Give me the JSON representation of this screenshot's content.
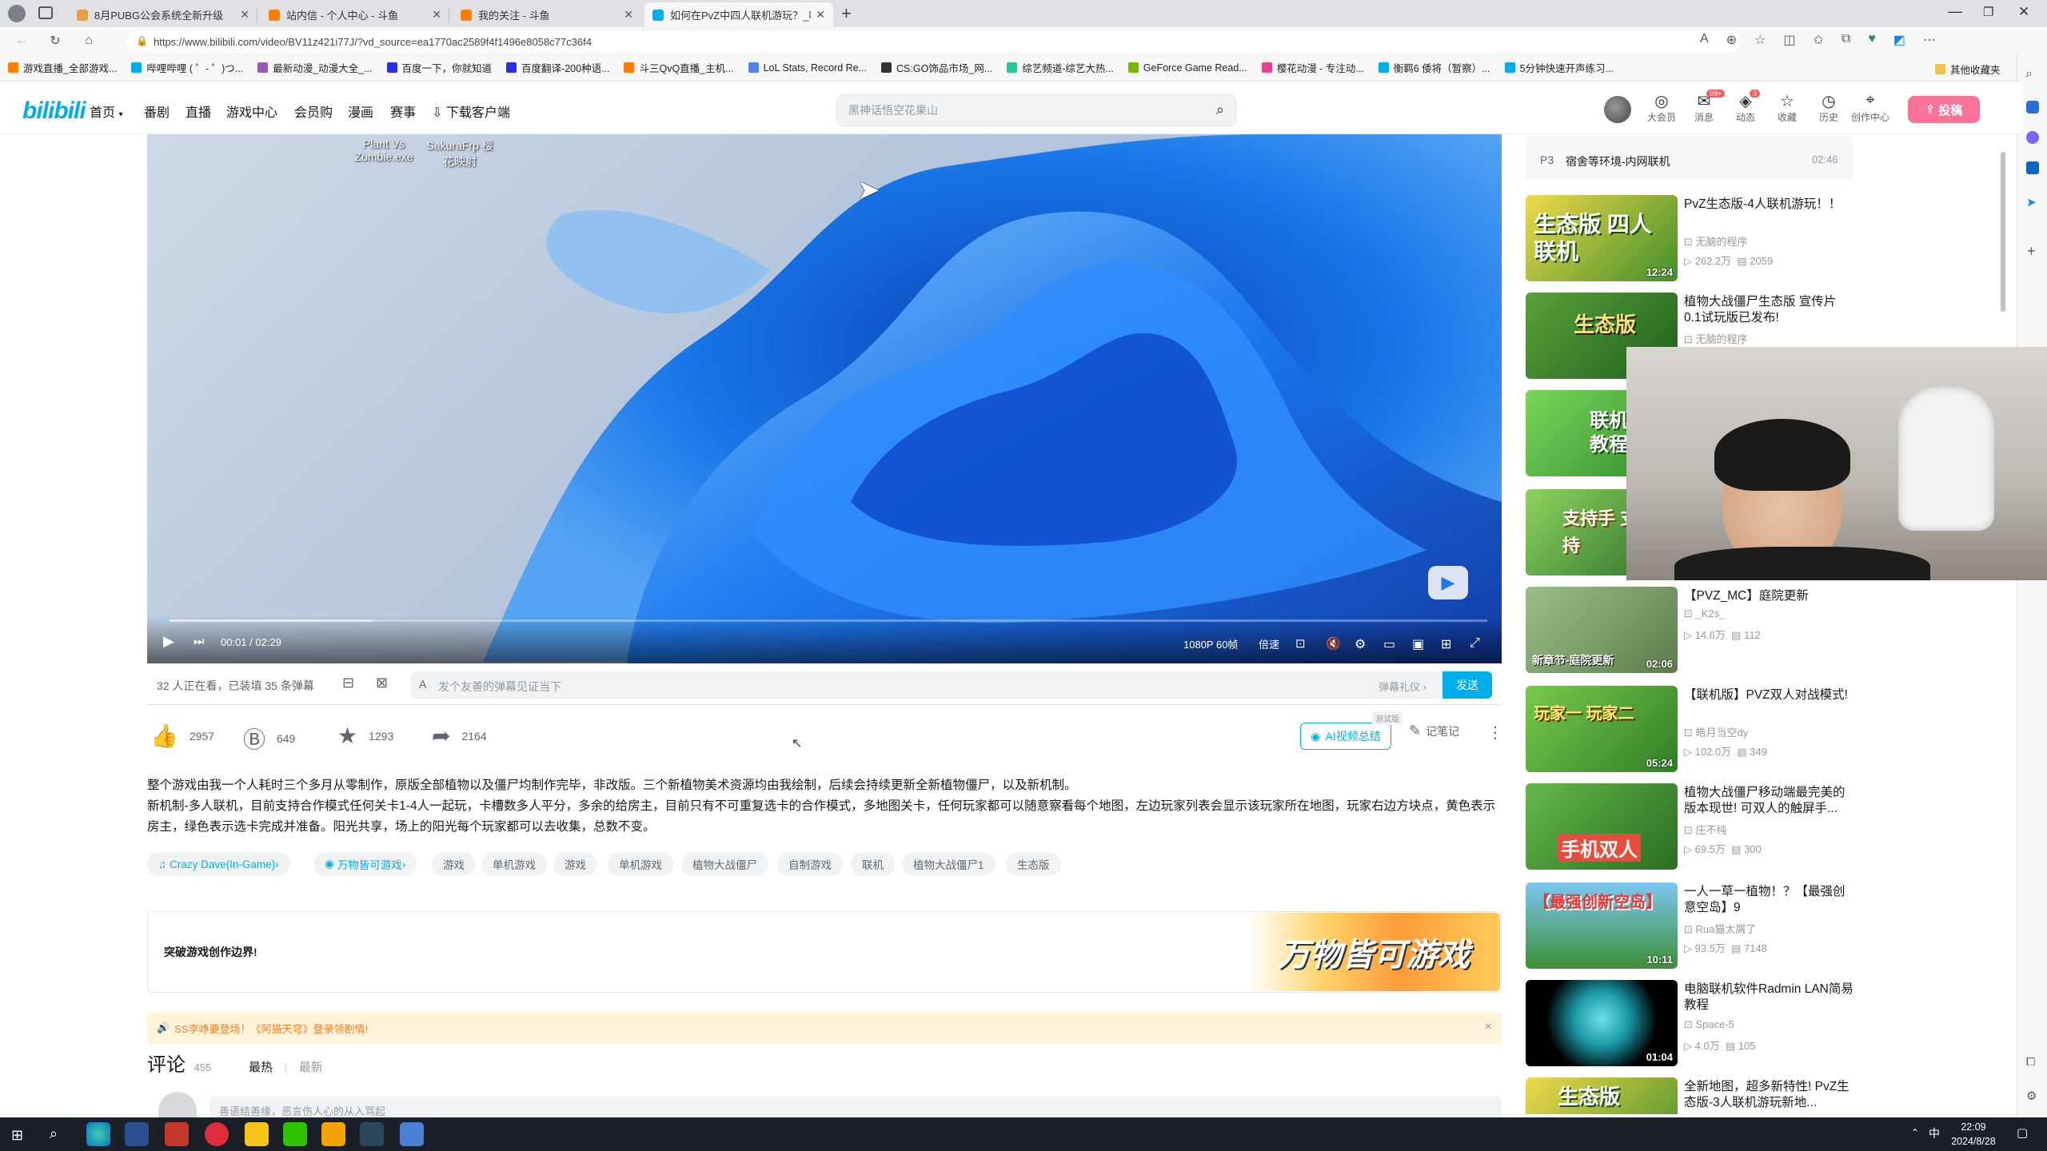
{
  "browser": {
    "tabs": [
      {
        "title": "8月PUBG公会系统全新升级",
        "color": "#e8a040"
      },
      {
        "title": "站内信 - 个人中心 - 斗鱼",
        "color": "#ff7d00"
      },
      {
        "title": "我的关注 - 斗鱼",
        "color": "#ff7d00"
      },
      {
        "title": "如何在PvZ中四人联机游玩？_哔哩",
        "color": "#00aeec"
      }
    ],
    "url": "https://www.bilibili.com/video/BV11z421i77J/?vd_source=ea1770ac2589f4f1496e8058c77c36f4",
    "bookmarks": [
      {
        "label": "游戏直播_全部游戏...",
        "color": "#ff7d00"
      },
      {
        "label": "哔哩哔哩 ( ゜- ゜)つ...",
        "color": "#00aeec"
      },
      {
        "label": "最新动漫_动漫大全_...",
        "color": "#9b59b6"
      },
      {
        "label": "百度一下，你就知道",
        "color": "#2932e1"
      },
      {
        "label": "百度翻译-200种语...",
        "color": "#2932e1"
      },
      {
        "label": "斗三QvQ直播_主机...",
        "color": "#ff7d00"
      },
      {
        "label": "LoL Stats, Record Re...",
        "color": "#5383e8"
      },
      {
        "label": "CS:GO饰品市场_网...",
        "color": "#333333"
      },
      {
        "label": "综艺频道-综艺大热...",
        "color": "#20c997"
      },
      {
        "label": "GeForce Game Read...",
        "color": "#76b900"
      },
      {
        "label": "樱花动漫 - 专注动...",
        "color": "#e84393"
      },
      {
        "label": "衡羁6 倭将（暂察）...",
        "color": "#00aeec"
      },
      {
        "label": "5分钟快速开声练习...",
        "color": "#00aeec"
      }
    ],
    "other_bookmarks": "其他收藏夹"
  },
  "header": {
    "logo": "bilibili",
    "nav": [
      "首页",
      "番剧",
      "直播",
      "游戏中心",
      "会员购",
      "漫画",
      "赛事",
      "下载客户端"
    ],
    "search_placeholder": "黑神话悟空花果山",
    "icons": [
      {
        "label": "大会员",
        "glyph": "◎"
      },
      {
        "label": "消息",
        "glyph": "✉",
        "badge": "99+"
      },
      {
        "label": "动态",
        "glyph": "◈",
        "badge": "3"
      },
      {
        "label": "收藏",
        "glyph": "☆"
      },
      {
        "label": "历史",
        "glyph": "◷"
      },
      {
        "label": "创作中心",
        "glyph": "⌖"
      }
    ],
    "upload": "投稿"
  },
  "player": {
    "overlay_left": "Plant Vs Zombie.exe",
    "overlay_right": "SakuraFrp 樱花映射",
    "time_current": "00:01",
    "time_total": "02:29",
    "progress": 0.007,
    "quality": "1080P 60帧",
    "speed": "倍速"
  },
  "danmaku": {
    "watching": "32 人正在看，已装填 35 条弹幕",
    "placeholder": "发个友善的弹幕见证当下",
    "etiquette": "弹幕礼仪",
    "send": "发送"
  },
  "toolbar": {
    "like": "2957",
    "coin": "649",
    "fav": "1293",
    "share": "2164",
    "ai_summary": "AI视频总结",
    "ai_badge": "测试版",
    "notes": "记笔记"
  },
  "description": {
    "line1": "整个游戏由我一个人耗时三个多月从零制作，原版全部植物以及僵尸均制作完毕，非改版。三个新植物美术资源均由我绘制，后续会持续更新全新植物僵尸，以及新机制。",
    "line2": "新机制-多人联机，目前支持合作模式任何关卡1-4人一起玩，卡槽数多人平分，多余的给房主，目前只有不可重复选卡的合作模式，多地图关卡，任何玩家都可以随意察看每个地图，左边玩家列表会显示该玩家所在地图，玩家右边方块点，黄色表示房主，绿色表示选卡完成并准备。阳光共享，场上的阳光每个玩家都可以去收集，总数不变。"
  },
  "tags": [
    "Crazy Dave(In-Game)",
    "万物皆可游戏",
    "游戏",
    "单机游戏",
    "游戏",
    "单机游戏",
    "植物大战僵尸",
    "自制游戏",
    "联机",
    "植物大战僵尸1",
    "生态版"
  ],
  "banner": {
    "text": "突破游戏创作边界!",
    "image_text": "万物皆可游戏"
  },
  "notice": {
    "text": "SS李峥要登场！《阿猫天穹》登录领剧情!",
    "close": "×"
  },
  "comments": {
    "title": "评论",
    "count": "455",
    "sort_hot": "最热",
    "sort_new": "最新",
    "input_placeholder": "善语结善缘，恶言伤人心的从入骂起"
  },
  "playlist": {
    "p3_label": "P3",
    "p3_title": "宿舍等环境-内网联机",
    "p3_time": "02:46"
  },
  "recommendations": [
    {
      "title": "PvZ生态版-4人联机游玩！！",
      "up": "无脑的程序",
      "views": "262.2万",
      "danmaku": "2059",
      "duration": "12:24",
      "thumb_text": "生态版 四人联机"
    },
    {
      "title": "植物大战僵尸生态版 宣传片 0.1试玩版已发布!",
      "up": "无脑的程序",
      "views": "",
      "danmaku": "",
      "duration": "",
      "thumb_text": "生态版"
    },
    {
      "title": "",
      "up": "",
      "views": "",
      "danmaku": "",
      "duration": "",
      "thumb_text": "联机版 教程"
    },
    {
      "title": "",
      "up": "",
      "views": "",
      "danmaku": "",
      "duration": "",
      "thumb_text": "支持手 支持"
    },
    {
      "title": "【PVZ_MC】庭院更新",
      "up": "_K2s_",
      "views": "14.6万",
      "danmaku": "112",
      "duration": "02:06",
      "thumb_text": "新章节-庭院更新"
    },
    {
      "title": "【联机版】PVZ双人对战模式!",
      "up": "皓月当空dy",
      "views": "102.0万",
      "danmaku": "349",
      "duration": "05:24",
      "thumb_text": "玩家一 玩家二"
    },
    {
      "title": "植物大战僵尸移动端最完美的版本现世! 可双人的触屏手...",
      "up": "庄不纯",
      "views": "69.5万",
      "danmaku": "300",
      "duration": "",
      "thumb_text": "手机双人"
    },
    {
      "title": "一人一草一植物！？【最强创意空岛】9",
      "up": "Rua猫太屑了",
      "views": "93.5万",
      "danmaku": "7148",
      "duration": "10:11",
      "thumb_text": "【最强创新空岛】"
    },
    {
      "title": "电脑联机软件Radmin LAN简易教程",
      "up": "Space-5",
      "views": "4.0万",
      "danmaku": "105",
      "duration": "01:04",
      "thumb_text": ""
    },
    {
      "title": "全新地图，超多新特性! PvZ生态版-3人联机游玩新地...",
      "up": "",
      "views": "",
      "danmaku": "",
      "duration": "",
      "thumb_text": "生态版"
    }
  ],
  "taskbar": {
    "time": "22:09",
    "date": "2024/8/28",
    "ime": "中"
  }
}
